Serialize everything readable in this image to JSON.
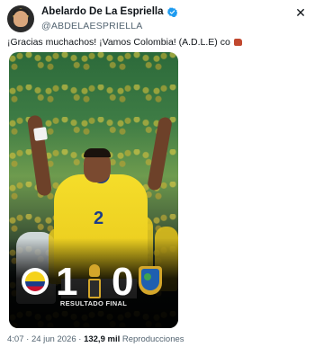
{
  "author": {
    "display_name": "Abelardo De La Espriella",
    "handle": "@ABDELAESPRIELLA",
    "verified": true
  },
  "header": {
    "close_icon": "close-icon"
  },
  "tweet": {
    "text": "¡Gracias muchachos! ¡Vamos Colombia! (A.D.L.E) co"
  },
  "media": {
    "home_score": "1",
    "away_score": "0",
    "result_label": "RESULTADO FINAL",
    "shirt_number": "2"
  },
  "meta": {
    "time": "4:07",
    "date": "24 jun 2026",
    "separator": "·",
    "views_count": "132,9 mil",
    "views_label": "Reproducciones"
  },
  "colors": {
    "verified_blue": "#1d9bf0",
    "text_primary": "#0f1419",
    "text_secondary": "#536471",
    "colombia_yellow": "#f5dd2a",
    "colombia_blue": "#1b3d8a"
  }
}
